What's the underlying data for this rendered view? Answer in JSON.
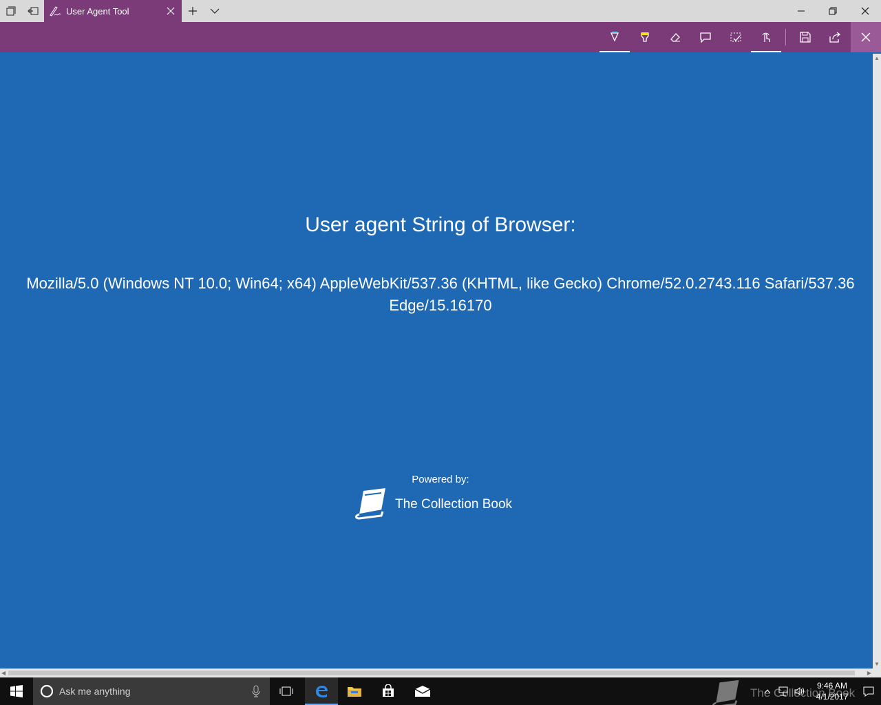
{
  "titlebar": {
    "tab_title": "User Agent Tool"
  },
  "inkbar": {
    "tools": [
      "ballpoint-pen",
      "highlighter",
      "eraser",
      "add-note",
      "clip",
      "touch-writing",
      "save",
      "share",
      "exit"
    ]
  },
  "page": {
    "heading": "User agent String of Browser:",
    "user_agent": "Mozilla/5.0 (Windows NT 10.0; Win64; x64) AppleWebKit/537.36 (KHTML, like Gecko) Chrome/52.0.2743.116 Safari/537.36 Edge/15.16170",
    "powered_by": "Powered by:",
    "brand": "The Collection Book"
  },
  "taskbar": {
    "search_placeholder": "Ask me anything",
    "time": "9:46 AM",
    "date": "4/1/2017",
    "watermark": "The Collection Book"
  },
  "colors": {
    "accent": "#7b3a78",
    "page_background": "#1f68b4",
    "taskbar": "#101010"
  }
}
